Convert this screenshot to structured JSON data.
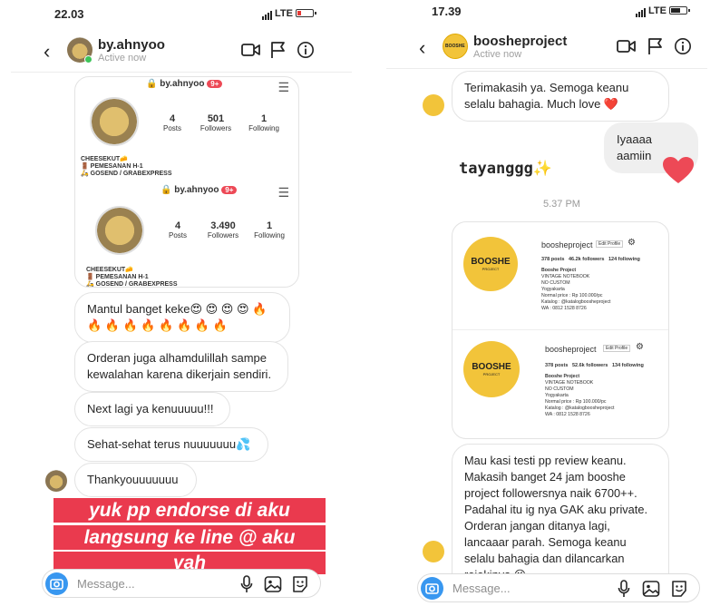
{
  "left": {
    "status": {
      "time": "22.03",
      "network": "LTE"
    },
    "header": {
      "name": "by.ahnyoo",
      "status": "Active now"
    },
    "profile_card": {
      "username": "by.ahnyoo",
      "badge": "9+",
      "stats_1": {
        "posts": "4",
        "posts_label": "Posts",
        "followers": "501",
        "followers_label": "Followers",
        "following": "1",
        "following_label": "Following"
      },
      "stats_2": {
        "posts": "4",
        "posts_label": "Posts",
        "followers": "3.490",
        "followers_label": "Followers",
        "following": "1",
        "following_label": "Following"
      },
      "bio_1": "CHEESEKUT",
      "bio_2": "PEMESANAN H-1",
      "bio_3": "GOSEND / GRABEXPRESS"
    },
    "messages": [
      "Mantul banget keke😍 😍 😍 😍 🔥 🔥 🔥 🔥 🔥 🔥 🔥 🔥 🔥",
      "Orderan juga alhamdulillah sampe kewalahan karena dikerjain sendiri.",
      "Next lagi ya kenuuuuu!!!",
      "Sehat-sehat terus nuuuuuuu💦",
      "Thankyouuuuuuu"
    ],
    "story_lines": [
      "yuk pp endorse di aku",
      "langsung ke line @ aku",
      "yah"
    ],
    "composer_placeholder": "Message..."
  },
  "right": {
    "status": {
      "time": "17.39",
      "network": "LTE"
    },
    "header": {
      "name": "boosheproject",
      "status": "Active now"
    },
    "messages": {
      "m1": "Terimakasih ya. Semoga keanu selalu bahagia. Much love ❤️",
      "m2": "Iyaaaa aamiin",
      "m3": "tayanggg✨",
      "time": "5.37 PM",
      "m4": "Mau kasi testi pp review keanu. Makasih banget 24 jam booshe project followersnya naik 6700++. Padahal itu ig nya GAK aku private. Orderan jangan ditanya lagi, lancaaar parah. Semoga keanu selalu bahagia dan dilancarkan rejekinya 😘"
    },
    "profile_card": {
      "logo": "BOOSHE",
      "logo_sub": "PROJECT",
      "username": "boosheproject",
      "edit": "Edit Profile",
      "stats_1": "378 posts   46.2k followers   124 following",
      "stats_2": "378 posts   52.6k followers   134 following",
      "bio": [
        "Booshe Project",
        "VINTAGE NOTEBOOK",
        "NO CUSTOM",
        "Yogyakarta",
        "Normal price : Rp 100.000/pc",
        "Katalog : @katalogboosheproject",
        "WA : 0812 1528 8726"
      ]
    },
    "composer_placeholder": "Message..."
  },
  "colors": {
    "accent": "#3897f0",
    "story_red": "#ea3a4e",
    "booshe_yellow": "#f2c43a",
    "heart": "#ed4956",
    "active": "#3ec45a"
  }
}
